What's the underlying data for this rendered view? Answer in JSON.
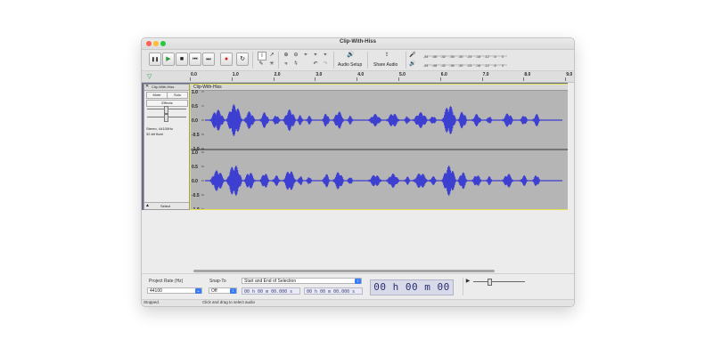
{
  "window": {
    "title": "Clip-With-Hiss",
    "close_color": "#fe5f57",
    "minimize_color": "#febc2e",
    "zoom_color": "#28c840"
  },
  "toolbar": {
    "pause_icon": "❚❚",
    "play_icon": "▶",
    "stop_icon": "■",
    "skip_start_icon": "⏮",
    "skip_end_icon": "⏭",
    "record_icon": "●",
    "loop_icon": "↻",
    "audio_setup_label": "Audio Setup",
    "share_audio_label": "Share Audio",
    "meter_ticks": [
      "-54",
      "-48",
      "-42",
      "-36",
      "-30",
      "-24",
      "-18",
      "-12",
      "-6",
      "0"
    ]
  },
  "ruler": {
    "ticks": [
      "0.0",
      "1.0",
      "2.0",
      "3.0",
      "4.0",
      "5.0",
      "6.0",
      "7.0",
      "8.0",
      "9.0"
    ]
  },
  "track": {
    "name": "Clip-With-Hiss",
    "mute_label": "Mute",
    "solo_label": "Solo",
    "effects_label": "Effects",
    "info_line1": "Stereo, 44100Hz",
    "info_line2": "32-bit float",
    "select_label": "Select",
    "clip_name": "Clip-With-Hiss",
    "scale_labels": [
      "1.0",
      "0.5",
      "0.0",
      "-0.5",
      "-1.0"
    ],
    "wave_color": "#3d3fd0"
  },
  "selection_toolbar": {
    "project_rate_label": "Project Rate (Hz)",
    "project_rate_value": "44100",
    "snap_to_label": "Snap-To",
    "snap_to_value": "Off",
    "selection_mode": "Start and End of Selection",
    "start_time": "00 h 00 m 00.000 s",
    "end_time": "00 h 00 m 00.000 s",
    "big_time": "00 h 00 m 00 s"
  },
  "status": {
    "state": "Stopped.",
    "hint": "Click and drag to select audio"
  }
}
